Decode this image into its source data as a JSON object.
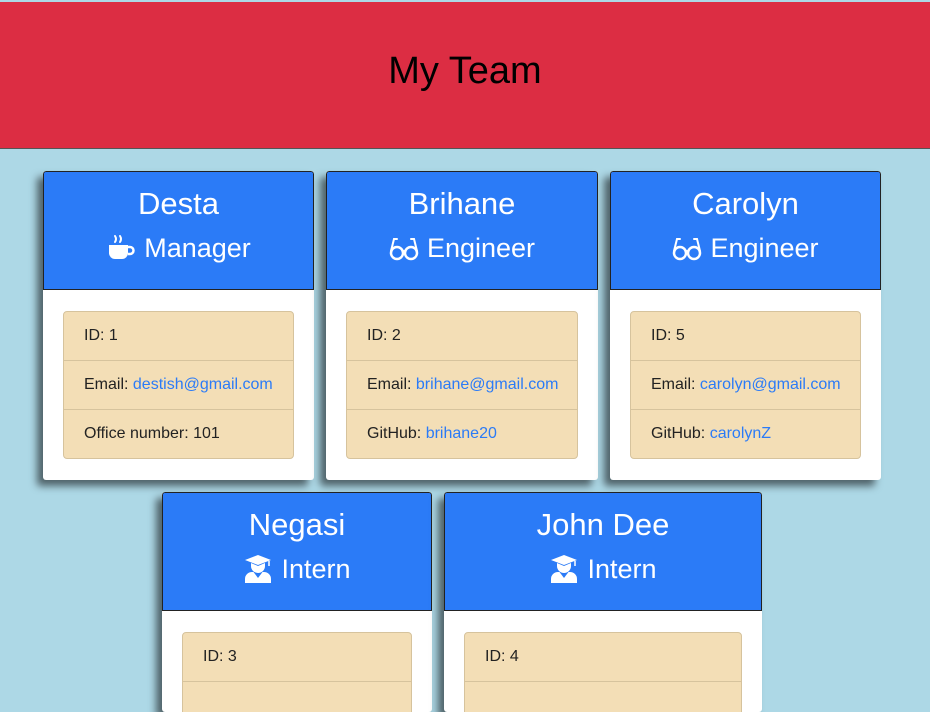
{
  "header": {
    "title": "My Team"
  },
  "team": [
    {
      "name": "Desta",
      "role": "Manager",
      "icon": "coffee-icon",
      "id_label": "ID:",
      "id": "1",
      "email_label": "Email:",
      "email": "destish@gmail.com",
      "extra_label": "Office number:",
      "extra": "101"
    },
    {
      "name": "Brihane",
      "role": "Engineer",
      "icon": "glasses-icon",
      "id_label": "ID:",
      "id": "2",
      "email_label": "Email:",
      "email": "brihane@gmail.com",
      "extra_label": "GitHub:",
      "extra": "brihane20"
    },
    {
      "name": "Carolyn",
      "role": "Engineer",
      "icon": "glasses-icon",
      "id_label": "ID:",
      "id": "5",
      "email_label": "Email:",
      "email": "carolyn@gmail.com",
      "extra_label": "GitHub:",
      "extra": "carolynZ"
    },
    {
      "name": "Negasi",
      "role": "Intern",
      "icon": "graduate-icon",
      "id_label": "ID:",
      "id": "3"
    },
    {
      "name": "John Dee",
      "role": "Intern",
      "icon": "graduate-icon",
      "id_label": "ID:",
      "id": "4"
    }
  ],
  "colors": {
    "header_bg": "#dc2d43",
    "page_bg": "#add8e6",
    "card_head_bg": "#2b7bf7",
    "info_bg": "#f3deb6",
    "link": "#2b7bf7"
  }
}
